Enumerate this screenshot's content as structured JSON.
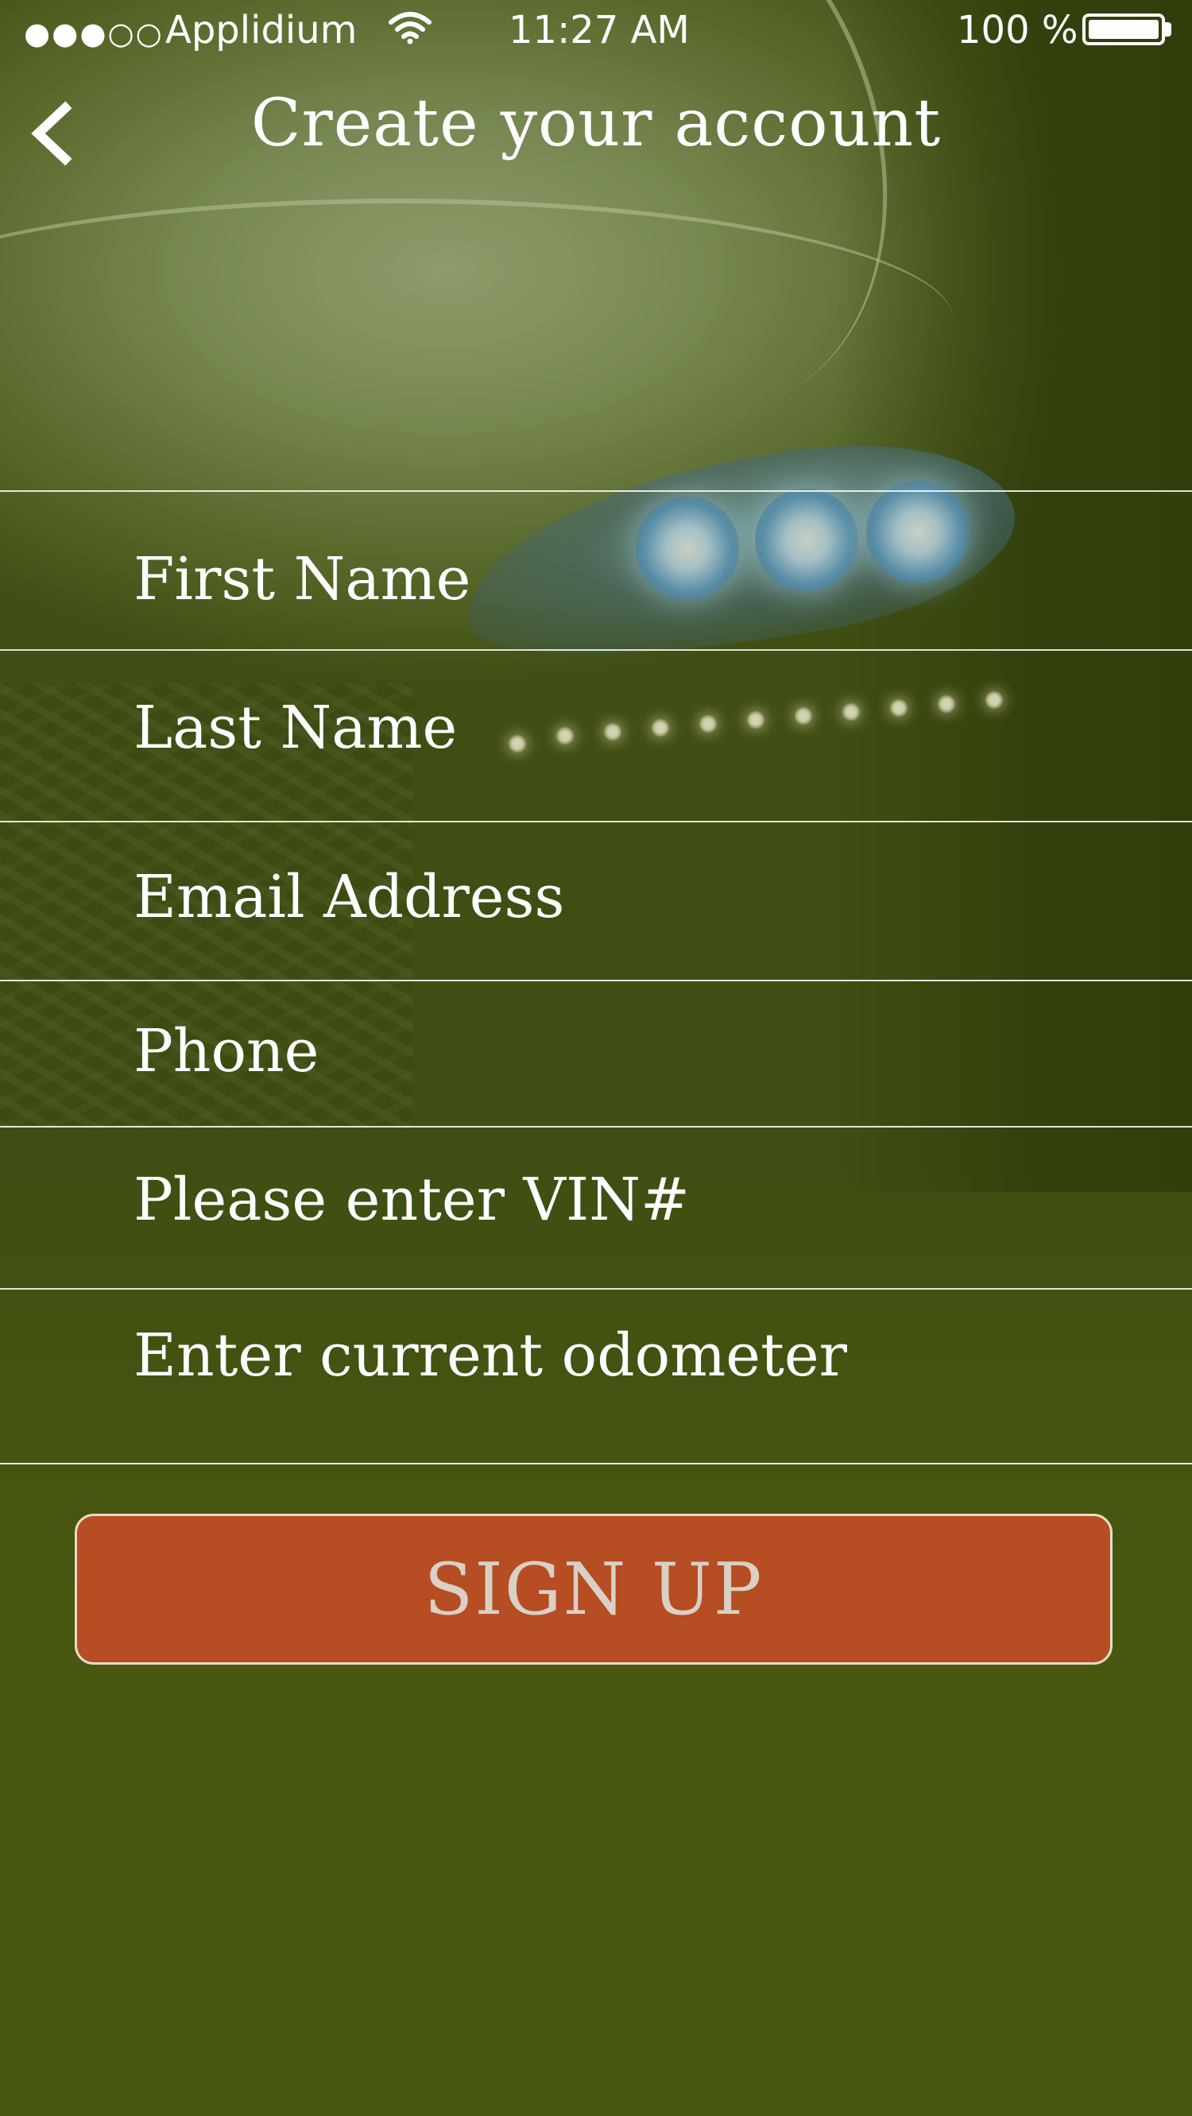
{
  "status_bar": {
    "signal_dots": "●●●○○",
    "carrier": "Applidium",
    "wifi_icon": "wifi-icon",
    "time": "11:27 AM",
    "battery_percent": "100 %",
    "battery_level": 1.0
  },
  "header": {
    "back_icon": "chevron-left-icon",
    "title": "Create your account"
  },
  "form": {
    "fields": [
      {
        "placeholder": "First Name",
        "value": ""
      },
      {
        "placeholder": "Last Name",
        "value": ""
      },
      {
        "placeholder": "Email Address",
        "value": ""
      },
      {
        "placeholder": "Phone",
        "value": ""
      },
      {
        "placeholder": "Please enter VIN#",
        "value": ""
      },
      {
        "placeholder": "Enter current odometer",
        "value": ""
      }
    ]
  },
  "actions": {
    "signup_label": "SIGN UP"
  },
  "colors": {
    "background": "#48570e",
    "button": "#b74d22",
    "button_border": "#e8dccb",
    "button_text": "#d9d0c6",
    "text": "#ffffff"
  }
}
